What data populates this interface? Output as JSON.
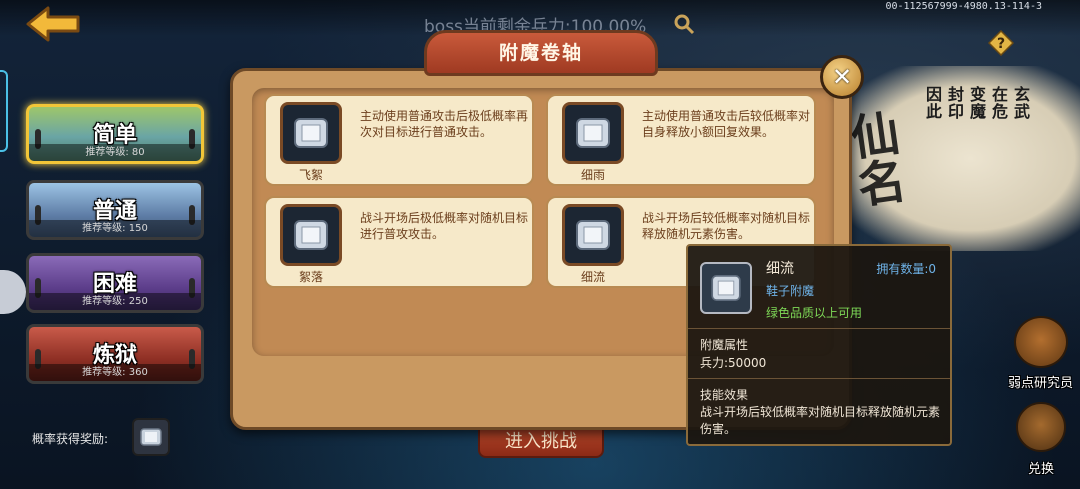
{
  "header": {
    "boss_text": "boss当前剩余兵力:100.00%",
    "server_id": "00-112567999-4980.13-114-3",
    "back_icon": "back-arrow-icon",
    "search_icon": "magnifier-icon",
    "help_icon": "help-icon"
  },
  "calligraphy": {
    "columns": [
      "玄武",
      "在危",
      "变魔",
      "封印",
      "因此"
    ],
    "big": "仙名"
  },
  "difficulties": [
    {
      "name": "简单",
      "level": "推荐等级: 80"
    },
    {
      "name": "普通",
      "level": "推荐等级: 150"
    },
    {
      "name": "困难",
      "level": "推荐等级: 250"
    },
    {
      "name": "炼狱",
      "level": "推荐等级: 360"
    }
  ],
  "reward": {
    "label": "概率获得奖励:"
  },
  "enter_button": "进入挑战",
  "right_menu": {
    "weak_label": "弱点研究员",
    "exchange_label": "兑换"
  },
  "panel": {
    "title": "附魔卷轴",
    "close_label": "✕",
    "cards": [
      {
        "name": "飞絮",
        "desc": "主动使用普通攻击后极低概率再次对目标进行普通攻击。"
      },
      {
        "name": "细雨",
        "desc": "主动使用普通攻击后较低概率对自身释放小额回复效果。"
      },
      {
        "name": "絮落",
        "desc": "战斗开场后极低概率对随机目标进行普攻攻击。"
      },
      {
        "name": "细流",
        "desc": "战斗开场后较低概率对随机目标释放随机元素伤害。"
      }
    ]
  },
  "tooltip": {
    "name": "细流",
    "count": "拥有数量:0",
    "type": "鞋子附魔",
    "quality": "绿色品质以上可用",
    "attr_heading": "附魔属性",
    "attr_value": "兵力:50000",
    "effect_heading": "技能效果",
    "effect_value": "战斗开场后较低概率对随机目标释放随机元素伤害。"
  },
  "colors": {
    "panel": "#c99961",
    "card": "#f6e9c9",
    "title_plate": "#c95a3b",
    "tooltip_blue": "#6fb3e8",
    "tooltip_green": "#7ed957"
  }
}
